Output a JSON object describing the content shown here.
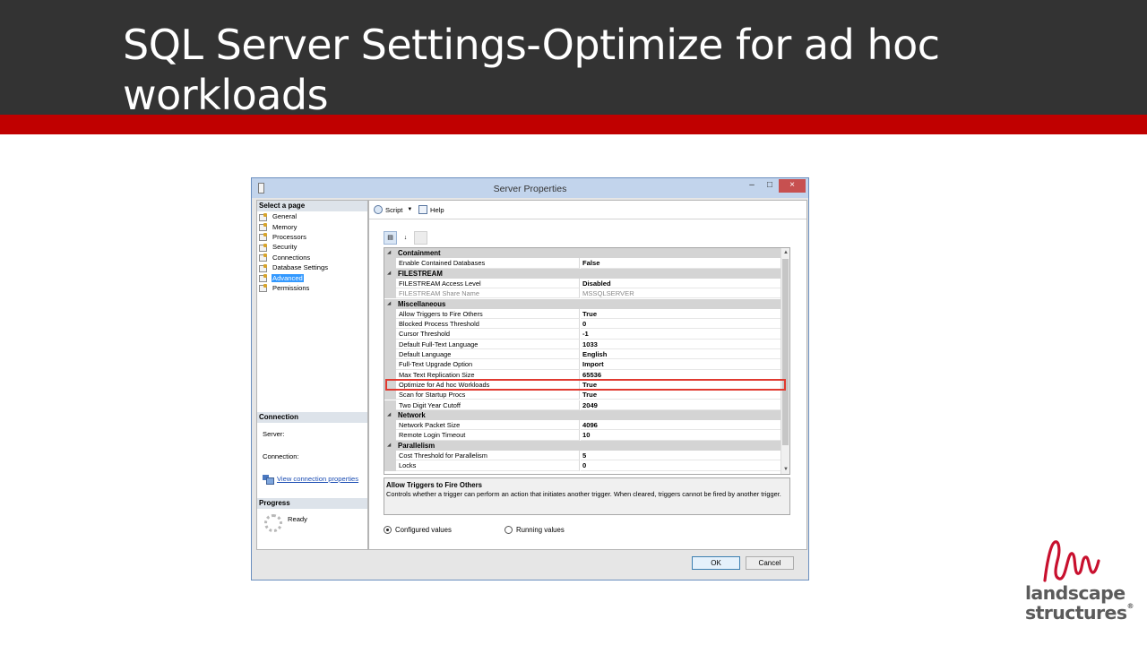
{
  "slide": {
    "title": "SQL Server Settings-Optimize for ad hoc workloads"
  },
  "window": {
    "title": "Server Properties",
    "controls": {
      "minimize": "–",
      "maximize": "□",
      "close": "×"
    }
  },
  "left_pane": {
    "select_page_header": "Select a page",
    "pages": [
      {
        "label": "General",
        "selected": false
      },
      {
        "label": "Memory",
        "selected": false
      },
      {
        "label": "Processors",
        "selected": false
      },
      {
        "label": "Security",
        "selected": false
      },
      {
        "label": "Connections",
        "selected": false
      },
      {
        "label": "Database Settings",
        "selected": false
      },
      {
        "label": "Advanced",
        "selected": true
      },
      {
        "label": "Permissions",
        "selected": false
      }
    ],
    "connection_header": "Connection",
    "server_label": "Server:",
    "connection_label": "Connection:",
    "view_connection_link": "View connection properties",
    "progress_header": "Progress",
    "progress_status": "Ready"
  },
  "toolbar": {
    "script_label": "Script",
    "help_label": "Help"
  },
  "property_grid": {
    "rows": [
      {
        "type": "category",
        "label": "Containment"
      },
      {
        "type": "property",
        "name": "Enable Contained Databases",
        "value": "False"
      },
      {
        "type": "category",
        "label": "FILESTREAM"
      },
      {
        "type": "property",
        "name": "FILESTREAM Access Level",
        "value": "Disabled"
      },
      {
        "type": "property",
        "name": "FILESTREAM Share Name",
        "value": "MSSQLSERVER",
        "greyed": true
      },
      {
        "type": "category",
        "label": "Miscellaneous"
      },
      {
        "type": "property",
        "name": "Allow Triggers to Fire Others",
        "value": "True"
      },
      {
        "type": "property",
        "name": "Blocked Process Threshold",
        "value": "0"
      },
      {
        "type": "property",
        "name": "Cursor Threshold",
        "value": "-1"
      },
      {
        "type": "property",
        "name": "Default Full-Text Language",
        "value": "1033"
      },
      {
        "type": "property",
        "name": "Default Language",
        "value": "English"
      },
      {
        "type": "property",
        "name": "Full-Text Upgrade Option",
        "value": "Import"
      },
      {
        "type": "property",
        "name": "Max Text Replication Size",
        "value": "65536"
      },
      {
        "type": "property",
        "name": "Optimize for Ad hoc Workloads",
        "value": "True",
        "highlighted": true
      },
      {
        "type": "property",
        "name": "Scan for Startup Procs",
        "value": "True"
      },
      {
        "type": "property",
        "name": "Two Digit Year Cutoff",
        "value": "2049"
      },
      {
        "type": "category",
        "label": "Network"
      },
      {
        "type": "property",
        "name": "Network Packet Size",
        "value": "4096"
      },
      {
        "type": "property",
        "name": "Remote Login Timeout",
        "value": "10"
      },
      {
        "type": "category",
        "label": "Parallelism"
      },
      {
        "type": "property",
        "name": "Cost Threshold for Parallelism",
        "value": "5"
      },
      {
        "type": "property",
        "name": "Locks",
        "value": "0"
      }
    ],
    "highlight_color": "#e03a30"
  },
  "description": {
    "title": "Allow Triggers to Fire Others",
    "text": "Controls whether a trigger can perform an action that initiates another trigger. When cleared, triggers cannot be fired by another trigger."
  },
  "options": {
    "configured_values_label": "Configured values",
    "running_values_label": "Running values",
    "selected": "configured"
  },
  "buttons": {
    "ok_label": "OK",
    "cancel_label": "Cancel"
  },
  "logo": {
    "line1": "landscape",
    "line2": "structures",
    "registered_mark": "®",
    "brand_color": "#c8102e"
  },
  "colors": {
    "header_bg": "#333333",
    "accent_red": "#c00000"
  }
}
